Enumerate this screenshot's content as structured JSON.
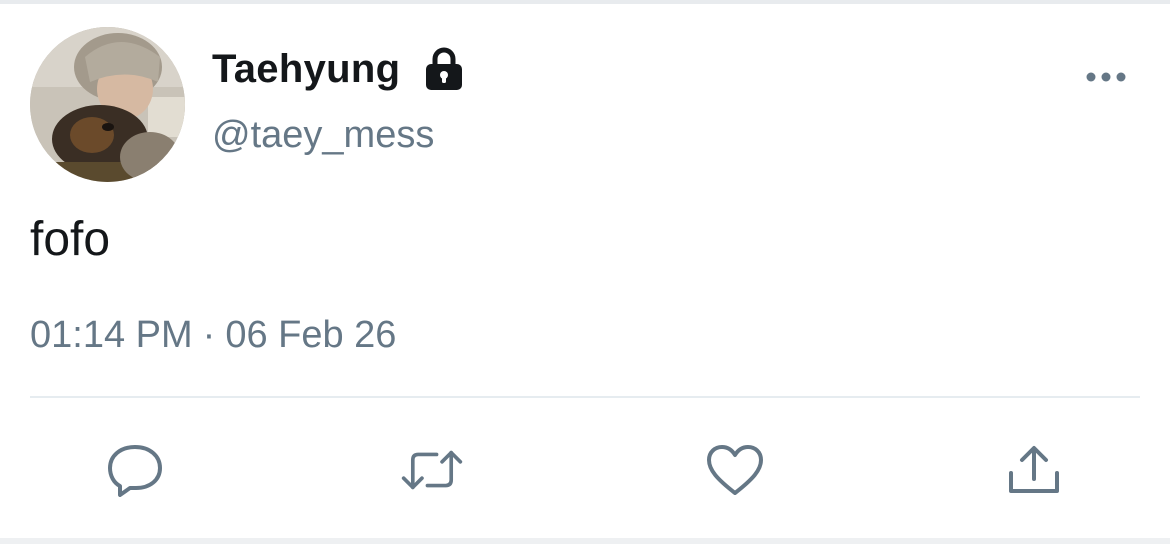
{
  "tweet": {
    "display_name": "Taehyung",
    "handle": "@taey_mess",
    "text": "fofo",
    "time": "01:14 PM",
    "separator": "·",
    "date": "06 Feb 26"
  },
  "icons": {
    "protected": "lock-icon",
    "more": "more-horizontal-icon",
    "reply": "reply-icon",
    "retweet": "retweet-icon",
    "like": "heart-icon",
    "share": "share-icon"
  },
  "colors": {
    "primary_text": "#14171a",
    "secondary_text": "#657786",
    "action_icons": "#657786",
    "divider": "#e6ecf0"
  }
}
